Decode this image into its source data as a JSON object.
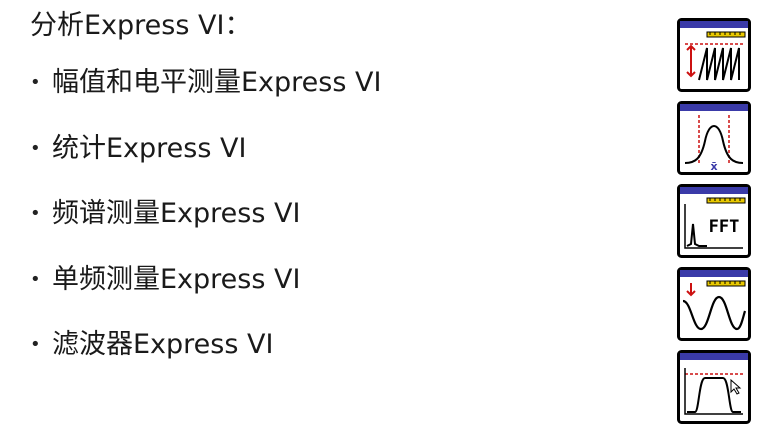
{
  "title": "分析Express VI：",
  "bullet_symbol": "•",
  "items": [
    {
      "label": "幅值和电平测量Express VI",
      "icon": "amplitude-level-icon"
    },
    {
      "label": "统计Express VI",
      "icon": "statistics-icon"
    },
    {
      "label": "频谱测量Express VI",
      "icon": "spectral-measurement-icon"
    },
    {
      "label": "单频测量Express VI",
      "icon": "tone-measurement-icon"
    },
    {
      "label": "滤波器Express VI",
      "icon": "filter-icon"
    }
  ],
  "icon_texts": {
    "statistics_symbol": "x̄",
    "fft_label": "FFT"
  },
  "colors": {
    "icon_frame": "#000000",
    "icon_header": "#3a3aa8",
    "icon_ruler": "#e8c800",
    "icon_marker_red": "#cc1111"
  }
}
